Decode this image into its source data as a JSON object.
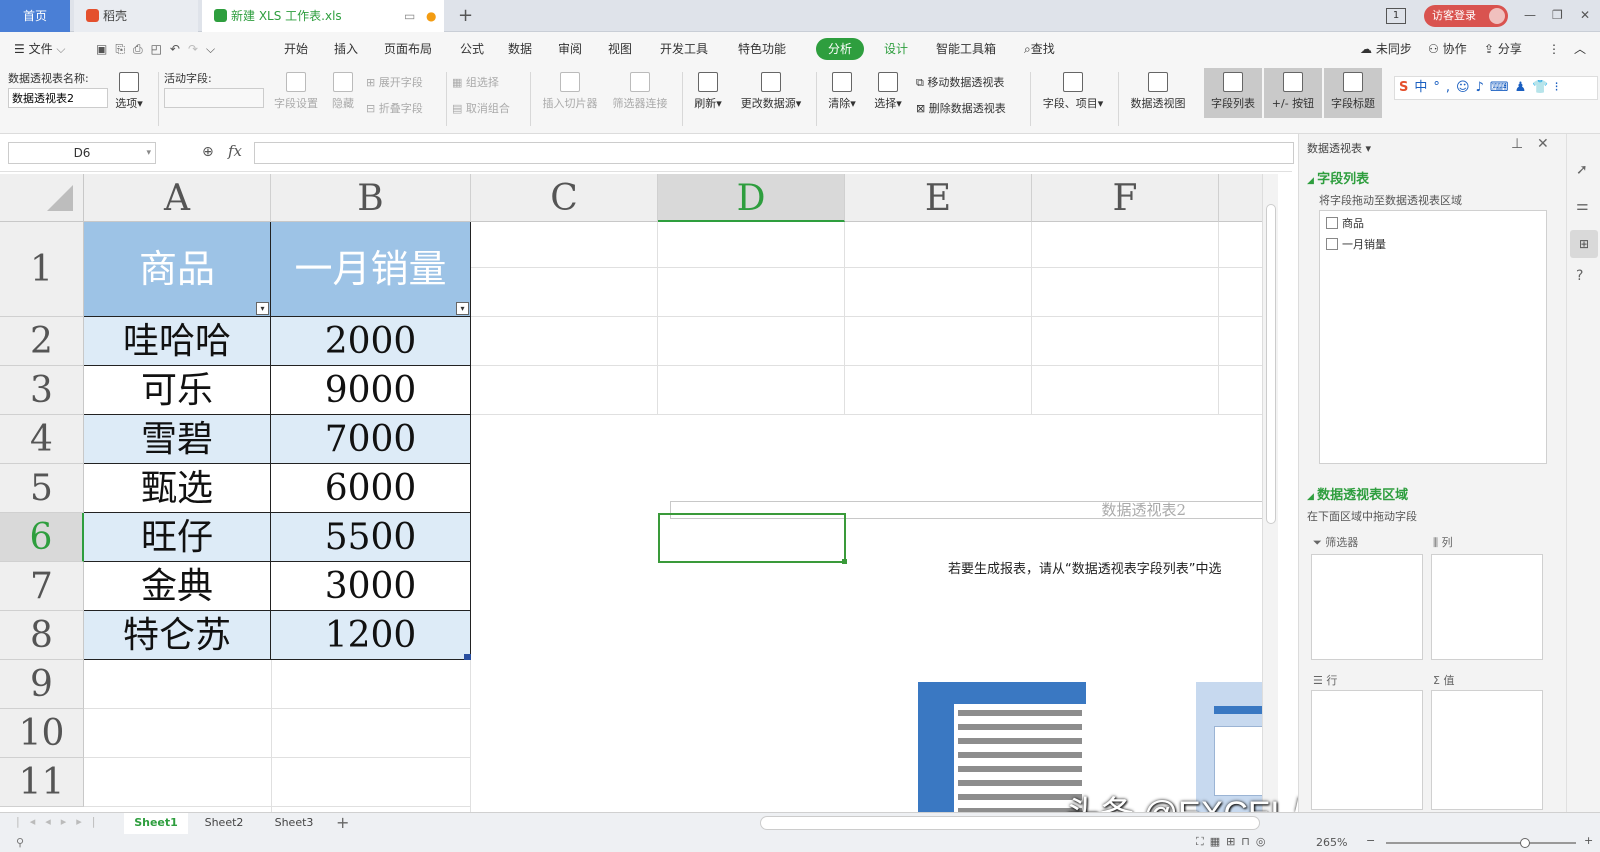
{
  "tabs": {
    "home": "首页",
    "daoke": "稻壳",
    "file": "新建 XLS 工作表.xls",
    "login": "访客登录",
    "box_count": "1"
  },
  "menu": {
    "file": "文件",
    "items": [
      "开始",
      "插入",
      "页面布局",
      "公式",
      "数据",
      "审阅",
      "视图",
      "开发工具",
      "特色功能",
      "分析",
      "设计",
      "智能工具箱"
    ],
    "search": "查找",
    "sync": "未同步",
    "collab": "协作",
    "share": "分享"
  },
  "ribbon": {
    "pt_name_label": "数据透视表名称:",
    "pt_name_value": "数据透视表2",
    "options": "选项",
    "active_field_label": "活动字段:",
    "field_settings": "字段设置",
    "hide": "隐藏",
    "expand_field": "展开字段",
    "collapse_field": "折叠字段",
    "group_select": "组选择",
    "ungroup": "取消组合",
    "insert_slicer": "插入切片器",
    "filter_conn": "筛选器连接",
    "refresh": "刷新",
    "change_source": "更改数据源",
    "clear": "清除",
    "select": "选择",
    "move_pt": "移动数据透视表",
    "delete_pt": "删除数据透视表",
    "fields_items": "字段、项目",
    "pivot_chart": "数据透视图",
    "field_list": "字段列表",
    "plus_minus": "+/- 按钮",
    "field_headers": "字段标题"
  },
  "formula": {
    "namebox": "D6",
    "fx": "fx",
    "content": ""
  },
  "grid": {
    "columns": [
      "A",
      "B",
      "C",
      "D",
      "E",
      "F"
    ],
    "rows": [
      "1",
      "2",
      "3",
      "4",
      "5",
      "6",
      "7",
      "8",
      "9",
      "10",
      "11"
    ],
    "header": [
      "商品",
      "一月销量"
    ],
    "data": [
      [
        "哇哈哈",
        "2000"
      ],
      [
        "可乐",
        "9000"
      ],
      [
        "雪碧",
        "7000"
      ],
      [
        "甄选",
        "6000"
      ],
      [
        "旺仔",
        "5500"
      ],
      [
        "金典",
        "3000"
      ],
      [
        "特仑苏",
        "1200"
      ]
    ],
    "pivot_title": "数据透视表2",
    "pivot_hint": "若要生成报表，请从“数据透视表字段列表”中选"
  },
  "panel": {
    "title": "数据透视表",
    "field_list": "字段列表",
    "drag_hint": "将字段拖动至数据透视表区域",
    "fields": [
      "商品",
      "一月销量"
    ],
    "areas_title": "数据透视表区域",
    "areas_hint": "在下面区域中拖动字段",
    "filter": "筛选器",
    "columns": "列",
    "rows": "行",
    "values": "值"
  },
  "sheets": [
    "Sheet1",
    "Sheet2",
    "Sheet3"
  ],
  "status": {
    "zoom": "265%"
  },
  "watermark": "头条 @EXCEL与WPS表格",
  "colors": {
    "header_fill": "#9dc3e6",
    "band_fill": "#ddebf7",
    "accent": "#2e9e3e",
    "selection": "#3a9a3a"
  }
}
